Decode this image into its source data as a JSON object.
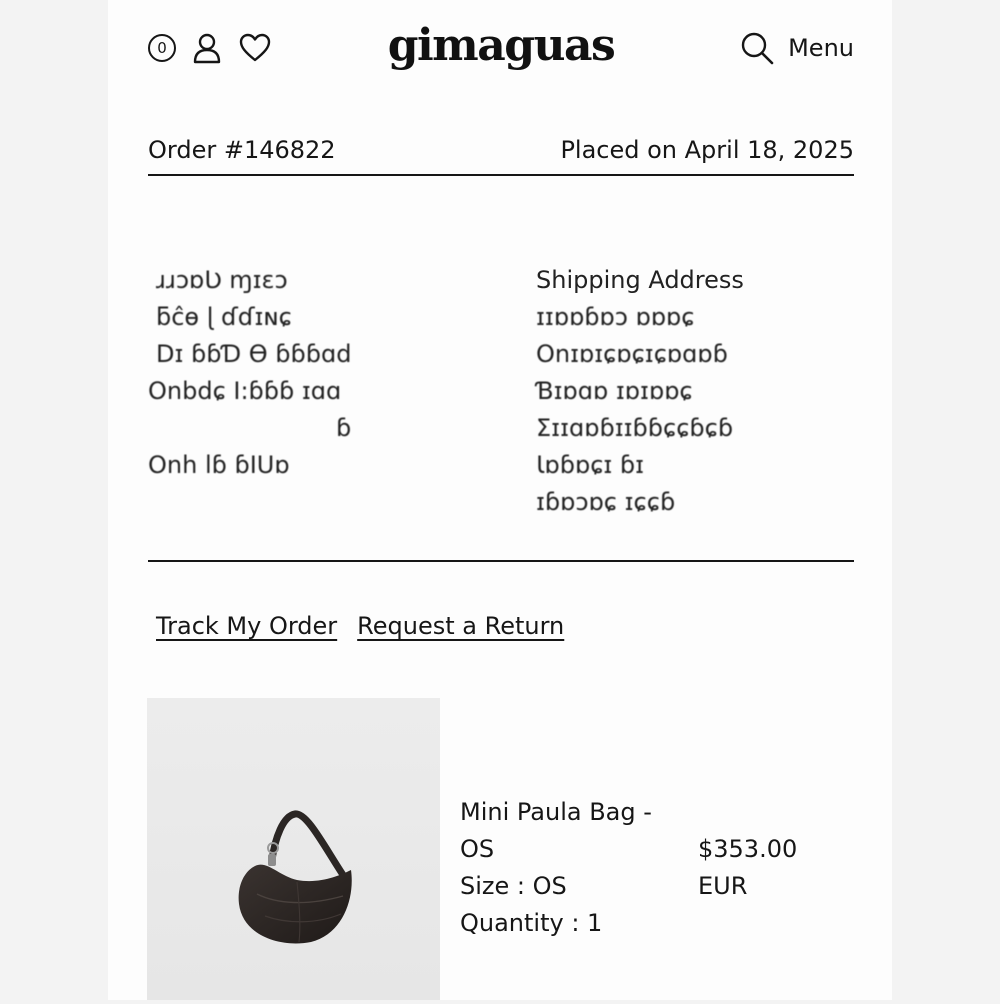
{
  "header": {
    "cart_count": "0",
    "logo": "gimaguas",
    "menu_label": "Menu",
    "icons": [
      "account-icon",
      "heart-icon",
      "search-icon"
    ]
  },
  "order": {
    "number": "Order #146822",
    "placed": "Placed on April 18, 2025"
  },
  "details": {
    "left_lines": [
      "ɹɹɔɒƲ ɱɪɛɔ",
      "ƃĉɵ ɭ ɗɗɪɴɕ",
      "Dɪ ɓɓƊ Ɵ ɓɓɓɑd",
      "Onbdɕ I:ɓɓɓ ɪɑɑ",
      "ɓ",
      "Onh lɓ ɓIUɒ"
    ],
    "shipping_title": "Shipping Address",
    "right_lines": [
      "ɪɪɒɒɓɒɔ ɒɒɒɕ",
      "Onɪɒɪɕɒɕɪɕɒɑɒɓ",
      "Ɓɪɒɑɒ   ɪɒɪɒɒɕ",
      "Ʃɪɪɑɒɓɪɪɓɓɕɕɓɕɓ",
      "Ɩɒɓɒɕɪ  ɓɪ",
      "ɪɓɒɔɒɕ  ɪɕɕɓ"
    ]
  },
  "actions": {
    "track": "Track My Order",
    "return": "Request a Return"
  },
  "product": {
    "name_line1": "Mini Paula Bag -",
    "name_line2": "OS",
    "size": "Size : OS",
    "quantity": "Quantity : 1",
    "price": "$353.00",
    "currency": "EUR",
    "image_subject": "black leather crescent shoulder bag",
    "colors": {
      "bag": "#2b2624",
      "image_bg": "#e9e9e9"
    }
  }
}
